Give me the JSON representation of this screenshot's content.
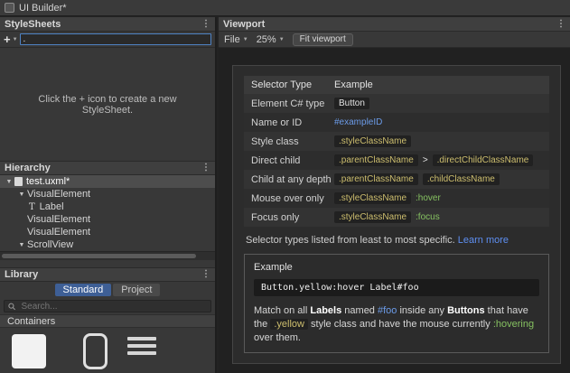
{
  "window": {
    "title": "UI Builder*"
  },
  "colors": {
    "yellow": "#CDBE6E",
    "green": "#86C261",
    "blue": "#6B9BE8",
    "link": "#5E8FF2",
    "tab_active": "#3E5F96",
    "focus": "#4F83C4"
  },
  "stylesheets": {
    "header": "StyleSheets",
    "add_button": "+",
    "selector_input": ".",
    "empty_message": "Click the + icon to create a new StyleSheet."
  },
  "hierarchy": {
    "header": "Hierarchy",
    "items": [
      {
        "label": "test.uxml*",
        "depth": 0,
        "arrow": true,
        "selected": true,
        "icon": "doc"
      },
      {
        "label": "VisualElement",
        "depth": 1,
        "arrow": true,
        "selected": false,
        "icon": null
      },
      {
        "label": "Label",
        "depth": 2,
        "arrow": false,
        "selected": false,
        "icon": "text"
      },
      {
        "label": "VisualElement",
        "depth": 1,
        "arrow": false,
        "selected": false,
        "icon": null
      },
      {
        "label": "VisualElement",
        "depth": 1,
        "arrow": false,
        "selected": false,
        "icon": null
      },
      {
        "label": "ScrollView",
        "depth": 1,
        "arrow": true,
        "selected": false,
        "icon": null
      }
    ]
  },
  "library": {
    "header": "Library",
    "tabs": [
      {
        "label": "Standard",
        "active": true
      },
      {
        "label": "Project",
        "active": false
      }
    ],
    "search_placeholder": "Search...",
    "category": "Containers",
    "thumbnails": [
      "visual-element",
      "scroll-view",
      "list-view"
    ]
  },
  "viewport": {
    "header": "Viewport",
    "file_menu": "File",
    "zoom": "25%",
    "fit_button": "Fit viewport"
  },
  "cheatsheet": {
    "columns": [
      "Selector Type",
      "Example"
    ],
    "rows": [
      {
        "label": "Element C# type",
        "tokens": [
          {
            "text": "Button",
            "style": "plain",
            "chip": true
          }
        ]
      },
      {
        "label": "Name or ID",
        "tokens": [
          {
            "text": "#exampleID",
            "style": "blue",
            "chip": false
          }
        ]
      },
      {
        "label": "Style class",
        "tokens": [
          {
            "text": ".styleClassName",
            "style": "yellow",
            "chip": true
          }
        ]
      },
      {
        "label": "Direct child",
        "tokens": [
          {
            "text": ".parentClassName",
            "style": "yellow",
            "chip": true
          },
          {
            "text": ">",
            "style": "plain",
            "chip": false
          },
          {
            "text": ".directChildClassName",
            "style": "yellow",
            "chip": true
          }
        ]
      },
      {
        "label": "Child at any depth",
        "tokens": [
          {
            "text": ".parentClassName",
            "style": "yellow",
            "chip": true
          },
          {
            "text": ".childClassName",
            "style": "yellow",
            "chip": true
          }
        ]
      },
      {
        "label": "Mouse over only",
        "tokens": [
          {
            "text": ".styleClassName",
            "style": "yellow",
            "chip": true
          },
          {
            "text": ":hover",
            "style": "green",
            "chip": false
          }
        ]
      },
      {
        "label": "Focus only",
        "tokens": [
          {
            "text": ".styleClassName",
            "style": "yellow",
            "chip": true
          },
          {
            "text": ":focus",
            "style": "green",
            "chip": false
          }
        ]
      }
    ],
    "note": "Selector types listed from least to most specific.",
    "link_label": "Learn more",
    "example": {
      "title": "Example",
      "code": "Button.yellow:hover Label#foo",
      "segments": [
        {
          "text": "Match on all ",
          "style": "plain"
        },
        {
          "text": "Labels",
          "style": "bold"
        },
        {
          "text": " named ",
          "style": "plain"
        },
        {
          "text": "#foo",
          "style": "blue"
        },
        {
          "text": " inside any ",
          "style": "plain"
        },
        {
          "text": "Buttons",
          "style": "bold"
        },
        {
          "text": " that have the ",
          "style": "plain"
        },
        {
          "text": ".yellow",
          "style": "chip-yellow"
        },
        {
          "text": " style class and have the mouse currently ",
          "style": "plain"
        },
        {
          "text": ":hovering",
          "style": "green"
        },
        {
          "text": " over them.",
          "style": "plain"
        }
      ]
    }
  }
}
